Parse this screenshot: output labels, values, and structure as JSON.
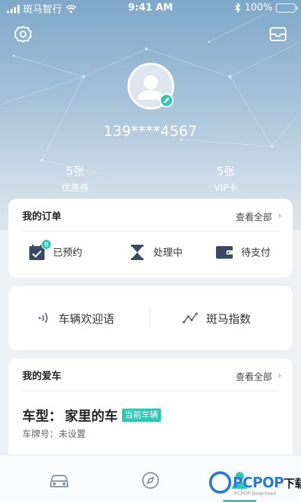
{
  "status_bar": {
    "carrier": "斑马智行",
    "time": "9:41 AM",
    "battery": "100%"
  },
  "header": {
    "settings_icon": "gear-icon",
    "messages_icon": "message-box-icon"
  },
  "profile": {
    "phone": "139****4567",
    "stats": [
      {
        "value": "5张",
        "label": "优惠券"
      },
      {
        "value": "5张",
        "label": "VIP卡"
      }
    ]
  },
  "orders": {
    "title": "我的订单",
    "view_all": "查看全部",
    "items": [
      {
        "label": "已预约",
        "icon": "calendar-check-icon",
        "badge": "8"
      },
      {
        "label": "处理中",
        "icon": "hourglass-icon"
      },
      {
        "label": "待支付",
        "icon": "wallet-icon"
      }
    ]
  },
  "features": {
    "items": [
      {
        "label": "车辆欢迎语",
        "icon": "sound-wave-icon"
      },
      {
        "label": "斑马指数",
        "icon": "trend-line-icon"
      }
    ]
  },
  "my_car": {
    "title": "我的爱车",
    "view_all": "查看全部",
    "model_label": "车型：",
    "model_name": "家里的车",
    "current_tag": "当前车辆",
    "plate_label": "车牌号：未设置"
  },
  "tabbar": {
    "tabs": [
      {
        "icon": "car-icon"
      },
      {
        "icon": "compass-icon"
      },
      {
        "icon": "person-icon",
        "active": true
      }
    ]
  },
  "watermark": {
    "brand_blue": "PCPOP",
    "brand_dark": "下载",
    "sub": "PCPOP Download"
  },
  "colors": {
    "accent": "#2fc7b2",
    "hero_top": "#7fa8c9",
    "hero_bottom": "#dde6ee"
  }
}
